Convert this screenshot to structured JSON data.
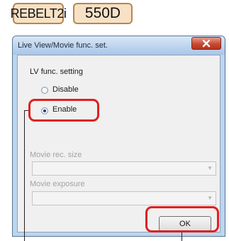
{
  "badges": [
    "REBELT2i",
    "550D"
  ],
  "window": {
    "title": "Live View/Movie func. set.",
    "close_icon": "x"
  },
  "lv_setting": {
    "label": "LV func. setting",
    "options": [
      {
        "label": "Disable",
        "selected": false
      },
      {
        "label": "Enable",
        "selected": true
      }
    ]
  },
  "movie_rec_size": {
    "label": "Movie rec. size",
    "value": "",
    "enabled": false
  },
  "movie_exposure": {
    "label": "Movie exposure",
    "value": "",
    "enabled": false
  },
  "ok_label": "OK",
  "colors": {
    "highlight": "#e02020",
    "badge_fill": "#f7e1c6",
    "badge_border": "#b6874f",
    "title_bar": "#bcd5ee",
    "close_button": "#c84a32"
  }
}
